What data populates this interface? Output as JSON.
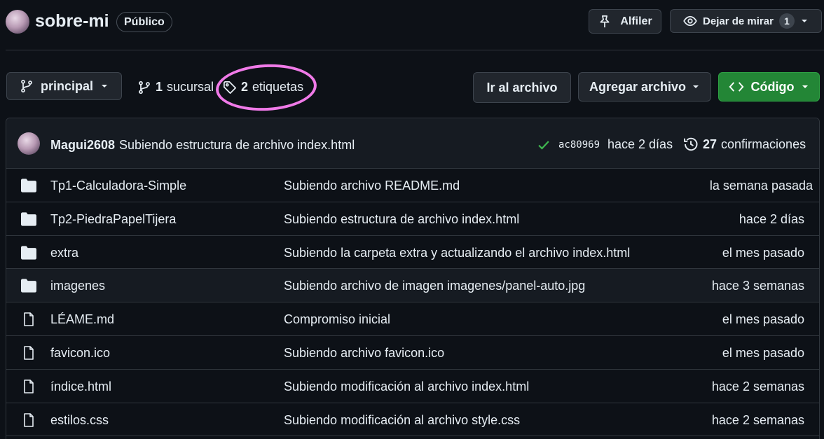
{
  "repo": {
    "name": "sobre-mi",
    "visibility": "Público"
  },
  "header": {
    "pin_label": "Alfiler",
    "watch_label": "Dejar de mirar",
    "watch_count": "1"
  },
  "toolbar": {
    "branch": "principal",
    "branches_count": "1",
    "branches_label": "sucursal",
    "tags_count": "2",
    "tags_label": "etiquetas",
    "goto_label": "Ir al archivo",
    "add_label": "Agregar archivo",
    "code_label": "Código"
  },
  "commit": {
    "author": "Magui2608",
    "message": "Subiendo estructura de archivo index.html",
    "sha": "ac80969",
    "time": "hace 2 días",
    "commits_count": "27",
    "commits_label": "confirmaciones"
  },
  "files": [
    {
      "type": "folder",
      "name": "Tp1-Calculadora-Simple",
      "message": "Subiendo archivo README.md",
      "time": "la semana pasada"
    },
    {
      "type": "folder",
      "name": "Tp2-PiedraPapelTijera",
      "message": "Subiendo estructura de archivo index.html",
      "time": "hace 2 días"
    },
    {
      "type": "folder",
      "name": "extra",
      "message": "Subiendo la carpeta extra y actualizando el archivo index.html",
      "time": "el mes pasado"
    },
    {
      "type": "folder",
      "name": "imagenes",
      "message": "Subiendo archivo de imagen imagenes/panel-auto.jpg",
      "time": "hace 3 semanas"
    },
    {
      "type": "file",
      "name": "LÉAME.md",
      "message": "Compromiso inicial",
      "time": "el mes pasado"
    },
    {
      "type": "file",
      "name": "favicon.ico",
      "message": "Subiendo archivo favicon.ico",
      "time": "el mes pasado"
    },
    {
      "type": "file",
      "name": "índice.html",
      "message": "Subiendo modificación al archivo index.html",
      "time": "hace 2 semanas"
    },
    {
      "type": "file",
      "name": "estilos.css",
      "message": "Subiendo modificación al archivo style.css",
      "time": "hace 2 semanas"
    }
  ],
  "colors": {
    "background": "#0d1117",
    "accent_green": "#238636",
    "highlight_ring": "#f07ae8",
    "check": "#3fb950"
  }
}
